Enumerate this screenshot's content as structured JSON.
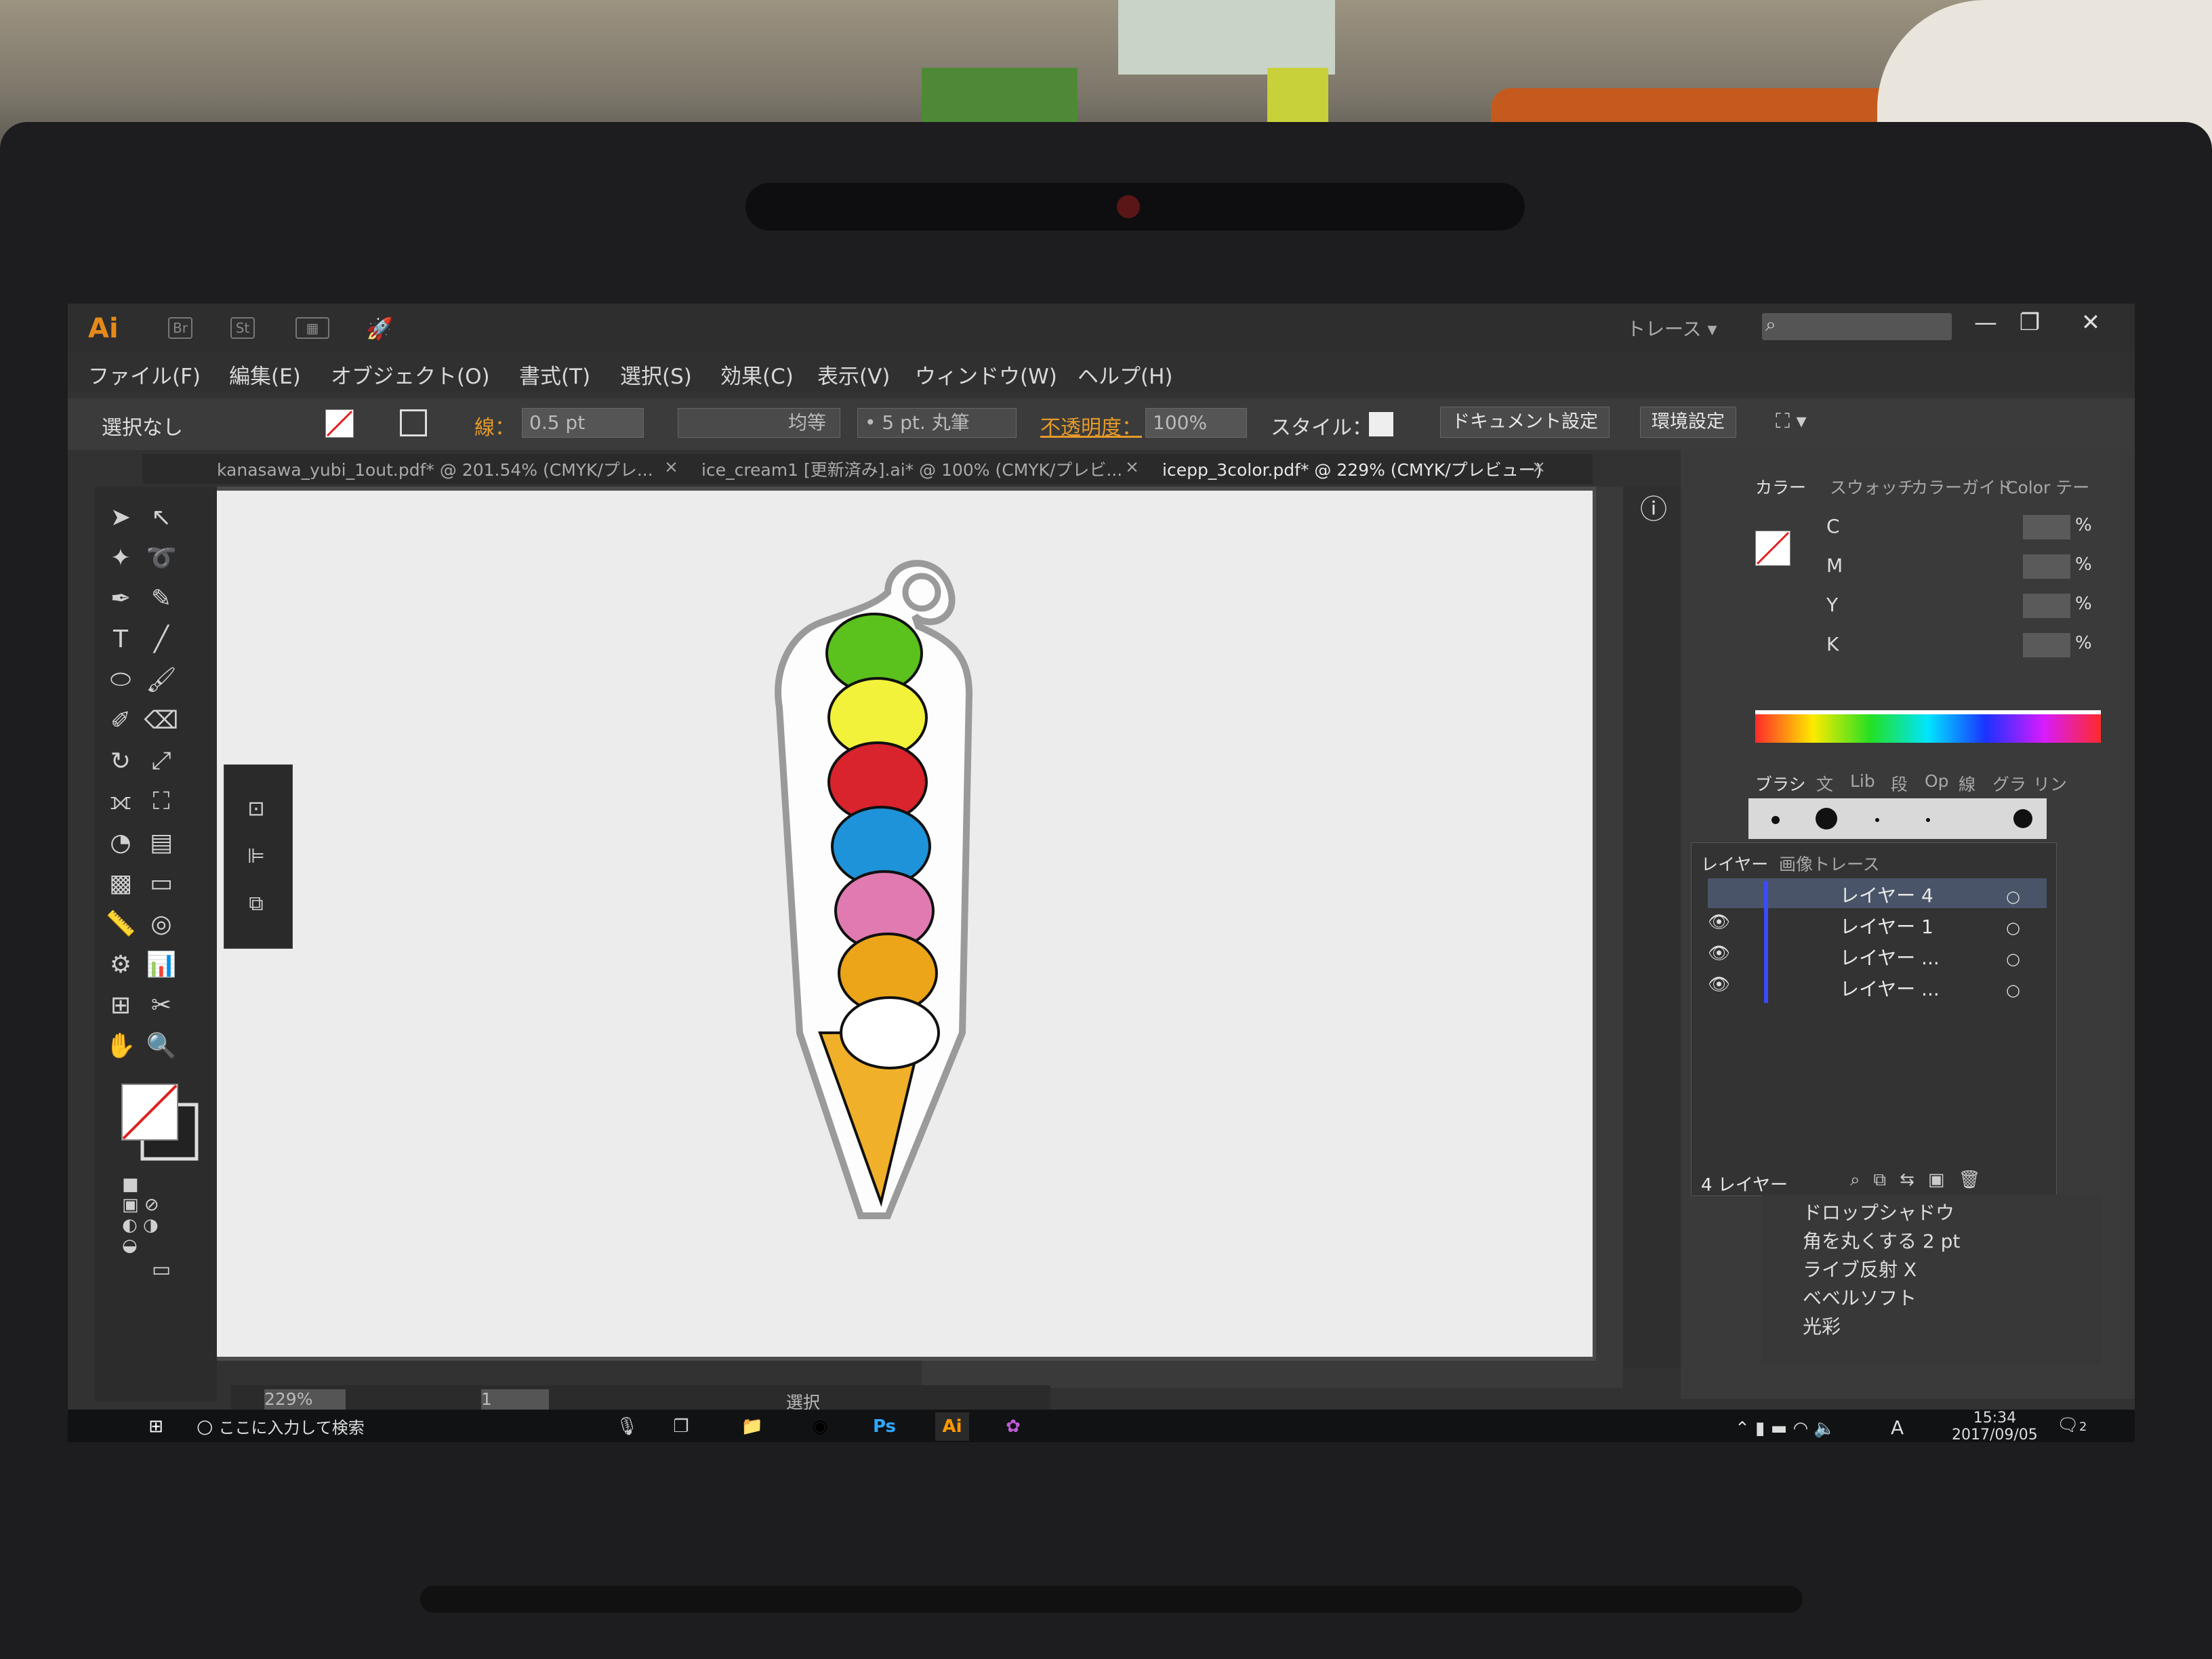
{
  "app": {
    "logo": "Ai",
    "br_icon": "Br",
    "st_icon": "St",
    "trace_dropdown": "トレース",
    "window_controls": [
      "—",
      "❐",
      "✕"
    ]
  },
  "menu": [
    "ファイル(F)",
    "編集(E)",
    "オブジェクト(O)",
    "書式(T)",
    "選択(S)",
    "効果(C)",
    "表示(V)",
    "ウィンドウ(W)",
    "ヘルプ(H)"
  ],
  "control_bar": {
    "selection": "選択なし",
    "stroke_label": "線：",
    "stroke_value": "0.5 pt",
    "profile": "均等",
    "brush": "5 pt. 丸筆",
    "opacity_label": "不透明度：",
    "opacity_value": "100%",
    "style_label": "スタイル：",
    "doc_settings": "ドキュメント設定",
    "env_settings": "環境設定"
  },
  "tabs": [
    {
      "label": "kanasawa_yubi_1out.pdf* @ 201.54% (CMYK/プレ...",
      "close": "×"
    },
    {
      "label": "ice_cream1 [更新済み].ai* @ 100% (CMYK/プレビ...",
      "close": "×"
    },
    {
      "label": "icepp_3color.pdf* @ 229% (CMYK/プレビュー)",
      "close": "×"
    }
  ],
  "status": {
    "zoom": "229%",
    "page": "1",
    "tool": "選択"
  },
  "color_panel": {
    "tabs": [
      "カラー",
      "スウォッチ",
      "カラーガイド",
      "Color テー"
    ],
    "channels": [
      "C",
      "M",
      "Y",
      "K"
    ],
    "unit": "%"
  },
  "brush_panel": {
    "tabs": [
      "ブラシ",
      "文",
      "Lib",
      "段",
      "Op",
      "線",
      "グラ",
      "リン"
    ]
  },
  "layers_panel": {
    "tabs": [
      "レイヤー",
      "画像トレース"
    ],
    "layers": [
      "レイヤー 4",
      "レイヤー 1",
      "レイヤー ...",
      "レイヤー ..."
    ],
    "count": "4 レイヤー"
  },
  "appearance_list": [
    "ドロップシャドウ",
    "角を丸くする 2 pt",
    "ライブ反射 X",
    "ベベルソフト",
    "光彩"
  ],
  "taskbar": {
    "search_placeholder": "ここに入力して検索",
    "time": "15:34",
    "date": "2017/09/05",
    "ime": "A",
    "notification_count": "2",
    "ps_label": "Ps",
    "ai_label": "Ai"
  },
  "artwork": {
    "scoop_colors": [
      "#5bc11d",
      "#f2f23a",
      "#d9232d",
      "#1e93d9",
      "#e07ab0",
      "#eca418",
      "#ffffff"
    ],
    "cone_color": "#f0b02a",
    "outline_color": "#9a9a9a"
  }
}
